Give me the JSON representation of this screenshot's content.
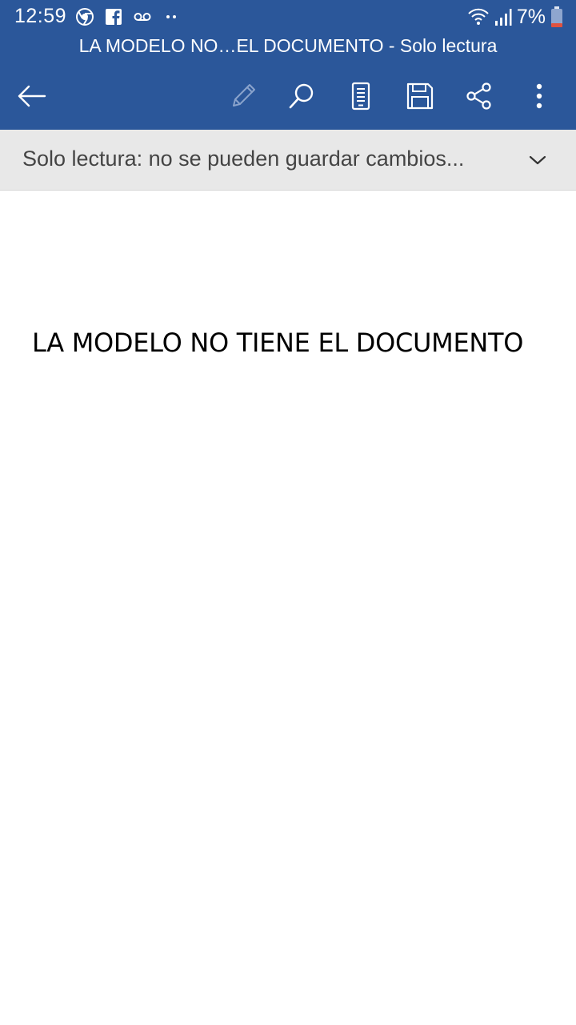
{
  "status_bar": {
    "time": "12:59",
    "battery_percent": "7%",
    "left_icons": [
      "chrome-icon",
      "facebook-icon",
      "voicemail-icon",
      "more-notifications-icon"
    ],
    "right_icons": [
      "wifi-icon",
      "signal-icon",
      "battery-icon"
    ]
  },
  "header": {
    "title": "LA MODELO NO…EL DOCUMENTO - Solo lectura",
    "toolbar": {
      "back_icon": "back-arrow-icon",
      "edit_icon": "pencil-icon",
      "find_icon": "search-icon",
      "read_mode_icon": "mobile-view-icon",
      "save_icon": "save-icon",
      "share_icon": "share-icon",
      "more_icon": "more-options-icon"
    }
  },
  "banner": {
    "text": "Solo lectura: no se pueden guardar cambios..."
  },
  "document": {
    "heading": "LA MODELO NO TIENE EL DOCUMENTO"
  },
  "colors": {
    "header_bg": "#2b579a",
    "banner_bg": "#e8e8e8",
    "battery_low": "#e0523f"
  }
}
